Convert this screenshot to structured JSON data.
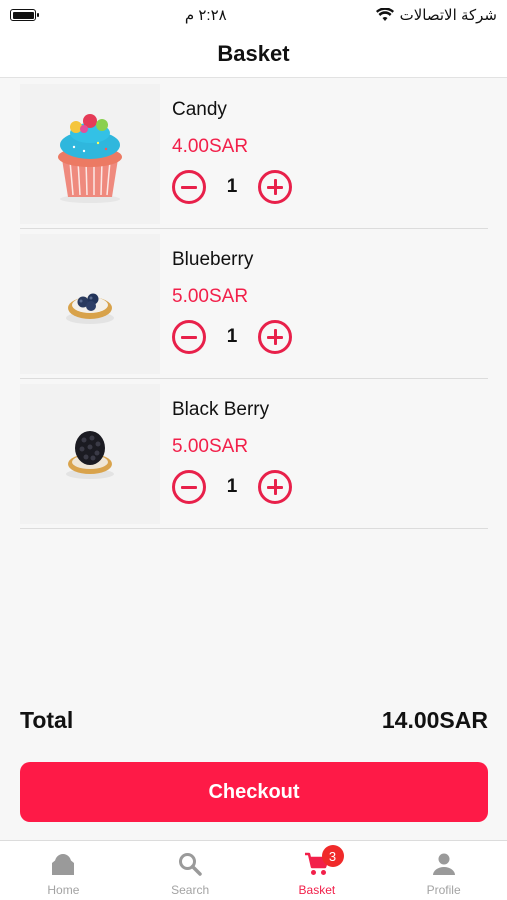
{
  "status_bar": {
    "time": "٢:٢٨ م",
    "carrier": "شركة الاتصالات"
  },
  "header": {
    "title": "Basket"
  },
  "items": [
    {
      "name": "Candy",
      "price": "4.00SAR",
      "quantity": "1",
      "image": "cupcake"
    },
    {
      "name": "Blueberry",
      "price": "5.00SAR",
      "quantity": "1",
      "image": "blueberry-tart"
    },
    {
      "name": "Black Berry",
      "price": "5.00SAR",
      "quantity": "1",
      "image": "blackberry-tart"
    }
  ],
  "total": {
    "label": "Total",
    "value": "14.00SAR"
  },
  "checkout": {
    "label": "Checkout"
  },
  "tabbar": {
    "tabs": [
      {
        "label": "Home",
        "icon": "home-icon"
      },
      {
        "label": "Search",
        "icon": "search-icon"
      },
      {
        "label": "Basket",
        "icon": "cart-icon",
        "badge": "3"
      },
      {
        "label": "Profile",
        "icon": "profile-icon"
      }
    ]
  },
  "colors": {
    "accent": "#fe1a47",
    "price": "#f2204a",
    "inactive_tab": "#a3a3a3"
  }
}
